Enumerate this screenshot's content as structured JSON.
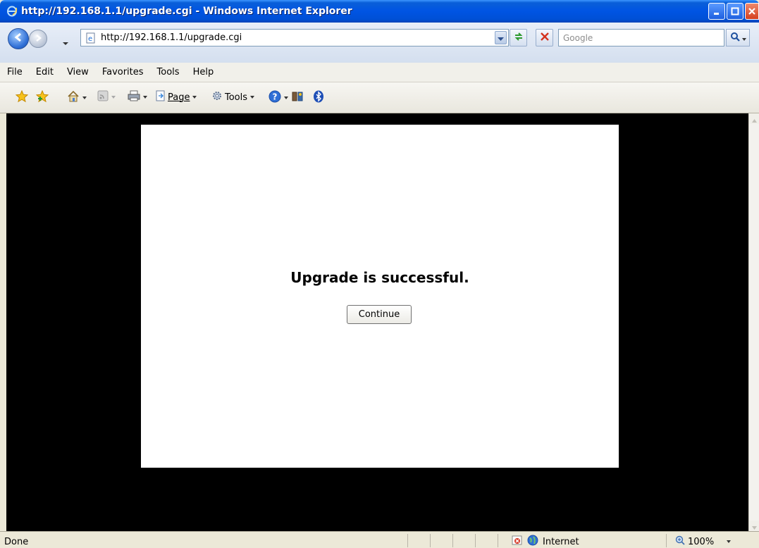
{
  "window": {
    "title": "http://192.168.1.1/upgrade.cgi - Windows Internet Explorer"
  },
  "navigation": {
    "address": "http://192.168.1.1/upgrade.cgi",
    "search_placeholder": "Google"
  },
  "menu": {
    "items": [
      "File",
      "Edit",
      "View",
      "Favorites",
      "Tools",
      "Help"
    ]
  },
  "command_bar": {
    "page_label": "Page",
    "tools_label": "Tools"
  },
  "page": {
    "message": "Upgrade is successful.",
    "continue_label": "Continue"
  },
  "status_bar": {
    "status": "Done",
    "zone": "Internet",
    "zoom": "100%"
  },
  "colors": {
    "titlebar": "#0054e3",
    "viewport_background": "#000000",
    "page_background": "#ffffff"
  }
}
